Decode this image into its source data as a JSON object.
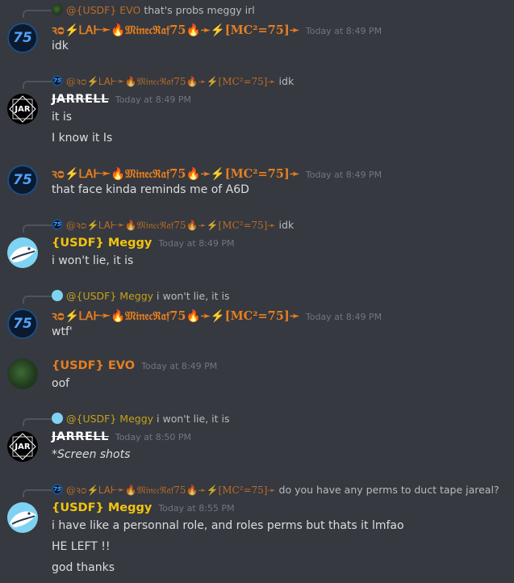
{
  "colors": {
    "background": "#36393f",
    "timestamp": "#72767d",
    "raf_name": "#e67e22",
    "usdf_name": "#f1c40f",
    "evo_name": "#e67e22"
  },
  "messages": [
    {
      "reply": {
        "avatar_icon": "evo-avatar-icon",
        "name": "@{USDF} EVO",
        "text": "that's probs meggy irl"
      },
      "author": "ꝛᴑ⚡ᏞᎪᎰ➛🔥𝔐𝔦𝔫𝔢𝔠ℜ𝔞𝔣75🔥➛⚡[MC²=75]➛",
      "author_color": "#e67e22",
      "timestamp": "Today at 8:49 PM",
      "lines": [
        "idk"
      ]
    },
    {
      "reply": {
        "avatar_icon": "75-avatar-icon",
        "name": "@ꝛᴑ⚡ᏞᎪᎰ➛🔥𝔐𝔦𝔫𝔢𝔠ℜ𝔞𝔣75🔥➛⚡[MC²=75]➛",
        "text": "idk"
      },
      "author": "JARRELL",
      "timestamp": "Today at 8:49 PM",
      "lines": [
        "it is",
        "I know it Is"
      ]
    },
    {
      "author": "ꝛᴑ⚡ᏞᎪᎰ➛🔥𝔐𝔦𝔫𝔢𝔠ℜ𝔞𝔣75🔥➛⚡[MC²=75]➛",
      "timestamp": "Today at 8:49 PM",
      "lines": [
        "that face kinda reminds me of A6D"
      ]
    },
    {
      "reply": {
        "avatar_icon": "75-avatar-icon",
        "name": "@ꝛᴑ⚡ᏞᎪᎰ➛🔥𝔐𝔦𝔫𝔢𝔠ℜ𝔞𝔣75🔥➛⚡[MC²=75]➛",
        "text": "idk"
      },
      "author": "{USDF} Meggy",
      "timestamp": "Today at 8:49 PM",
      "lines": [
        "i won't lie, it is"
      ]
    },
    {
      "reply": {
        "avatar_icon": "meggy-avatar-icon",
        "name": "@{USDF} Meggy",
        "text": "i won't lie, it is"
      },
      "author": "ꝛᴑ⚡ᏞᎪᎰ➛🔥𝔐𝔦𝔫𝔢𝔠ℜ𝔞𝔣75🔥➛⚡[MC²=75]➛",
      "timestamp": "Today at 8:49 PM",
      "lines": [
        "wtf'"
      ]
    },
    {
      "author": "{USDF} EVO",
      "timestamp": "Today at 8:49 PM",
      "lines": [
        "oof"
      ]
    },
    {
      "reply": {
        "avatar_icon": "meggy-avatar-icon",
        "name": "@{USDF} Meggy",
        "text": "i won't lie, it is"
      },
      "author": "JARRELL",
      "timestamp": "Today at 8:50 PM",
      "lines": [
        "*Screen shots"
      ]
    },
    {
      "reply": {
        "avatar_icon": "75-avatar-icon",
        "name": "@ꝛᴑ⚡ᏞᎪᎰ➛🔥𝔐𝔦𝔫𝔢𝔠ℜ𝔞𝔣75🔥➛⚡[MC²=75]➛",
        "text": "do you have any perms to duct tape jareal?"
      },
      "author": "{USDF} Meggy",
      "timestamp": "Today at 8:55 PM",
      "lines": [
        "i have like a personnal role, and roles perms but thats it lmfao",
        "HE LEFT !!",
        "god thanks"
      ]
    }
  ],
  "avatar_labels": {
    "raf": "75",
    "jar": "JAR"
  }
}
